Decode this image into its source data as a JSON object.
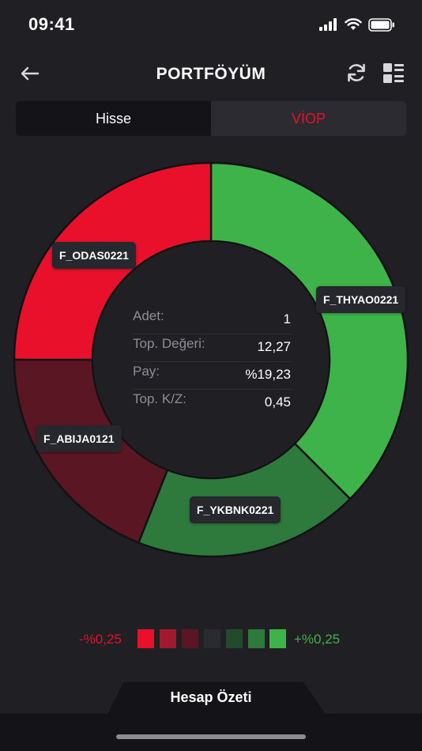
{
  "status_bar": {
    "time": "09:41"
  },
  "header": {
    "title": "PORTFÖYÜM"
  },
  "tabs": [
    {
      "label": "Hisse",
      "active": true
    },
    {
      "label": "VİOP",
      "active": false
    }
  ],
  "chart_data": {
    "type": "pie",
    "style": "donut",
    "slices": [
      {
        "label": "F_THYAO0221",
        "value": 37.5,
        "color": "#3db34a"
      },
      {
        "label": "F_YKBNK0221",
        "value": 18.5,
        "color": "#2e7a3c"
      },
      {
        "label": "F_ABIJA0121",
        "value": 19.0,
        "color": "#5a1623"
      },
      {
        "label": "F_ODAS0221",
        "value": 25.0,
        "color": "#e8102a"
      }
    ]
  },
  "details": [
    {
      "key": "Adet:",
      "value": "1"
    },
    {
      "key": "Top. Değeri:",
      "value": "12,27"
    },
    {
      "key": "Pay:",
      "value": "%19,23"
    },
    {
      "key": "Top. K/Z:",
      "value": "0,45"
    }
  ],
  "legend": {
    "min_label": "-%0,25",
    "max_label": "+%0,25",
    "scale_colors": [
      "#e8102a",
      "#a0192c",
      "#5a1623",
      "#2a2a31",
      "#224a2b",
      "#2e7a3c",
      "#3db34a"
    ]
  },
  "bottom_tab": {
    "label": "Hesap Özeti"
  }
}
